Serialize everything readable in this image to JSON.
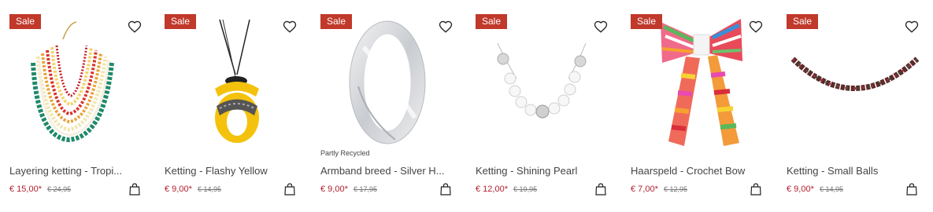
{
  "colors": {
    "sale_badge": "#c0392b",
    "price_new": "#b21f2d",
    "price_old": "#777777"
  },
  "icons": {
    "favorite": "heart-icon",
    "cart": "shopping-bag-icon"
  },
  "products": [
    {
      "badge": "Sale",
      "title": "Layering ketting - Tropi...",
      "price": "€ 15,00*",
      "old_price": "€ 24,95",
      "note": ""
    },
    {
      "badge": "Sale",
      "title": "Ketting - Flashy Yellow",
      "price": "€ 9,00*",
      "old_price": "€ 14,95",
      "note": ""
    },
    {
      "badge": "Sale",
      "title": "Armband breed - Silver H...",
      "price": "€ 9,00*",
      "old_price": "€ 17,95",
      "note": "Partly Recycled"
    },
    {
      "badge": "Sale",
      "title": "Ketting - Shining Pearl",
      "price": "€ 12,00*",
      "old_price": "€ 19,95",
      "note": ""
    },
    {
      "badge": "Sale",
      "title": "Haarspeld - Crochet Bow",
      "price": "€ 7,00*",
      "old_price": "€ 12,95",
      "note": ""
    },
    {
      "badge": "Sale",
      "title": "Ketting - Small Balls",
      "price": "€ 9,00*",
      "old_price": "€ 14,95",
      "note": ""
    }
  ]
}
